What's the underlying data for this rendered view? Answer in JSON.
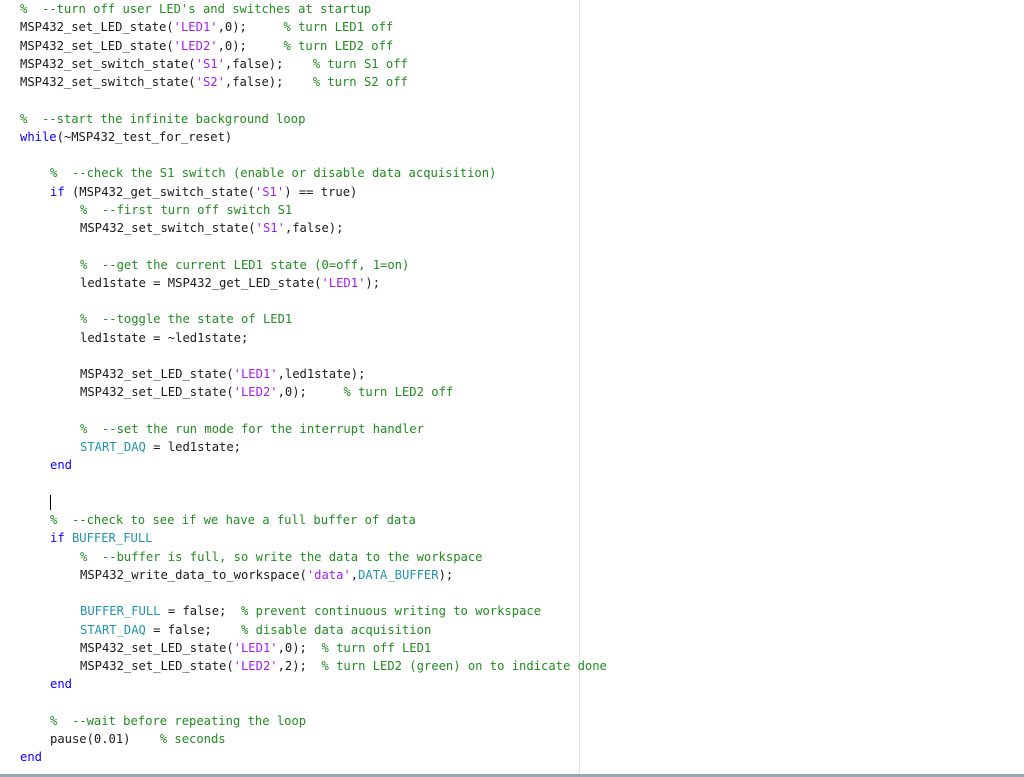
{
  "editor": {
    "language": "matlab",
    "colors": {
      "comment": "#228b22",
      "string": "#a020f0",
      "keyword": "#0e00ff",
      "variable": "#2394ab",
      "plain": "#1a1a1a"
    },
    "lines": [
      {
        "indent": 0,
        "tokens": [
          {
            "t": "c",
            "v": "%  --turn off user LED's and switches at startup"
          }
        ]
      },
      {
        "indent": 0,
        "tokens": [
          {
            "t": "p",
            "v": "MSP432_set_LED_state("
          },
          {
            "t": "s",
            "v": "'LED1'"
          },
          {
            "t": "p",
            "v": ",0);     "
          },
          {
            "t": "c",
            "v": "% turn LED1 off"
          }
        ]
      },
      {
        "indent": 0,
        "tokens": [
          {
            "t": "p",
            "v": "MSP432_set_LED_state("
          },
          {
            "t": "s",
            "v": "'LED2'"
          },
          {
            "t": "p",
            "v": ",0);     "
          },
          {
            "t": "c",
            "v": "% turn LED2 off"
          }
        ]
      },
      {
        "indent": 0,
        "tokens": [
          {
            "t": "p",
            "v": "MSP432_set_switch_state("
          },
          {
            "t": "s",
            "v": "'S1'"
          },
          {
            "t": "p",
            "v": ",false);    "
          },
          {
            "t": "c",
            "v": "% turn S1 off"
          }
        ]
      },
      {
        "indent": 0,
        "tokens": [
          {
            "t": "p",
            "v": "MSP432_set_switch_state("
          },
          {
            "t": "s",
            "v": "'S2'"
          },
          {
            "t": "p",
            "v": ",false);    "
          },
          {
            "t": "c",
            "v": "% turn S2 off"
          }
        ]
      },
      {
        "indent": 0,
        "tokens": []
      },
      {
        "indent": 0,
        "tokens": [
          {
            "t": "c",
            "v": "%  --start the infinite background loop"
          }
        ]
      },
      {
        "indent": 0,
        "tokens": [
          {
            "t": "k",
            "v": "while"
          },
          {
            "t": "p",
            "v": "(~MSP432_test_for_reset)"
          }
        ]
      },
      {
        "indent": 0,
        "tokens": []
      },
      {
        "indent": 1,
        "tokens": [
          {
            "t": "c",
            "v": "%  --check the S1 switch (enable or disable data acquisition)"
          }
        ]
      },
      {
        "indent": 1,
        "tokens": [
          {
            "t": "k",
            "v": "if"
          },
          {
            "t": "p",
            "v": " (MSP432_get_switch_state("
          },
          {
            "t": "s",
            "v": "'S1'"
          },
          {
            "t": "p",
            "v": ") == true)"
          }
        ]
      },
      {
        "indent": 2,
        "tokens": [
          {
            "t": "c",
            "v": "%  --first turn off switch S1"
          }
        ]
      },
      {
        "indent": 2,
        "tokens": [
          {
            "t": "p",
            "v": "MSP432_set_switch_state("
          },
          {
            "t": "s",
            "v": "'S1'"
          },
          {
            "t": "p",
            "v": ",false);"
          }
        ]
      },
      {
        "indent": 0,
        "tokens": []
      },
      {
        "indent": 2,
        "tokens": [
          {
            "t": "c",
            "v": "%  --get the current LED1 state (0=off, 1=on)"
          }
        ]
      },
      {
        "indent": 2,
        "tokens": [
          {
            "t": "p",
            "v": "led1state = MSP432_get_LED_state("
          },
          {
            "t": "s",
            "v": "'LED1'"
          },
          {
            "t": "p",
            "v": ");"
          }
        ]
      },
      {
        "indent": 0,
        "tokens": []
      },
      {
        "indent": 2,
        "tokens": [
          {
            "t": "c",
            "v": "%  --toggle the state of LED1"
          }
        ]
      },
      {
        "indent": 2,
        "tokens": [
          {
            "t": "p",
            "v": "led1state = ~led1state;"
          }
        ]
      },
      {
        "indent": 0,
        "tokens": []
      },
      {
        "indent": 2,
        "tokens": [
          {
            "t": "p",
            "v": "MSP432_set_LED_state("
          },
          {
            "t": "s",
            "v": "'LED1'"
          },
          {
            "t": "p",
            "v": ",led1state);"
          }
        ]
      },
      {
        "indent": 2,
        "tokens": [
          {
            "t": "p",
            "v": "MSP432_set_LED_state("
          },
          {
            "t": "s",
            "v": "'LED2'"
          },
          {
            "t": "p",
            "v": ",0);     "
          },
          {
            "t": "c",
            "v": "% turn LED2 off"
          }
        ]
      },
      {
        "indent": 0,
        "tokens": []
      },
      {
        "indent": 2,
        "tokens": [
          {
            "t": "c",
            "v": "%  --set the run mode for the interrupt handler"
          }
        ]
      },
      {
        "indent": 2,
        "tokens": [
          {
            "t": "v",
            "v": "START_DAQ"
          },
          {
            "t": "p",
            "v": " = led1state;"
          }
        ]
      },
      {
        "indent": 1,
        "tokens": [
          {
            "t": "k",
            "v": "end"
          }
        ]
      },
      {
        "indent": 0,
        "tokens": []
      },
      {
        "indent": 0,
        "tokens": []
      },
      {
        "indent": 1,
        "tokens": [
          {
            "t": "c",
            "v": "%  --check to see if we have a full buffer of data"
          }
        ]
      },
      {
        "indent": 1,
        "tokens": [
          {
            "t": "k",
            "v": "if"
          },
          {
            "t": "p",
            "v": " "
          },
          {
            "t": "v",
            "v": "BUFFER_FULL"
          }
        ]
      },
      {
        "indent": 2,
        "tokens": [
          {
            "t": "c",
            "v": "%  --buffer is full, so write the data to the workspace"
          }
        ]
      },
      {
        "indent": 2,
        "tokens": [
          {
            "t": "p",
            "v": "MSP432_write_data_to_workspace("
          },
          {
            "t": "s",
            "v": "'data'"
          },
          {
            "t": "p",
            "v": ","
          },
          {
            "t": "v",
            "v": "DATA_BUFFER"
          },
          {
            "t": "p",
            "v": ");"
          }
        ]
      },
      {
        "indent": 0,
        "tokens": []
      },
      {
        "indent": 2,
        "tokens": [
          {
            "t": "v",
            "v": "BUFFER_FULL"
          },
          {
            "t": "p",
            "v": " = false;  "
          },
          {
            "t": "c",
            "v": "% prevent continuous writing to workspace"
          }
        ]
      },
      {
        "indent": 2,
        "tokens": [
          {
            "t": "v",
            "v": "START_DAQ"
          },
          {
            "t": "p",
            "v": " = false;    "
          },
          {
            "t": "c",
            "v": "% disable data acquisition"
          }
        ]
      },
      {
        "indent": 2,
        "tokens": [
          {
            "t": "p",
            "v": "MSP432_set_LED_state("
          },
          {
            "t": "s",
            "v": "'LED1'"
          },
          {
            "t": "p",
            "v": ",0);  "
          },
          {
            "t": "c",
            "v": "% turn off LED1"
          }
        ]
      },
      {
        "indent": 2,
        "tokens": [
          {
            "t": "p",
            "v": "MSP432_set_LED_state("
          },
          {
            "t": "s",
            "v": "'LED2'"
          },
          {
            "t": "p",
            "v": ",2);  "
          },
          {
            "t": "c",
            "v": "% turn LED2 (green) on to indicate done"
          }
        ]
      },
      {
        "indent": 1,
        "tokens": [
          {
            "t": "k",
            "v": "end"
          }
        ]
      },
      {
        "indent": 0,
        "tokens": []
      },
      {
        "indent": 1,
        "tokens": [
          {
            "t": "c",
            "v": "%  --wait before repeating the loop"
          }
        ]
      },
      {
        "indent": 1,
        "tokens": [
          {
            "t": "p",
            "v": "pause(0.01)    "
          },
          {
            "t": "c",
            "v": "% seconds"
          }
        ]
      },
      {
        "indent": 0,
        "tokens": [
          {
            "t": "k",
            "v": "end"
          }
        ]
      }
    ]
  }
}
